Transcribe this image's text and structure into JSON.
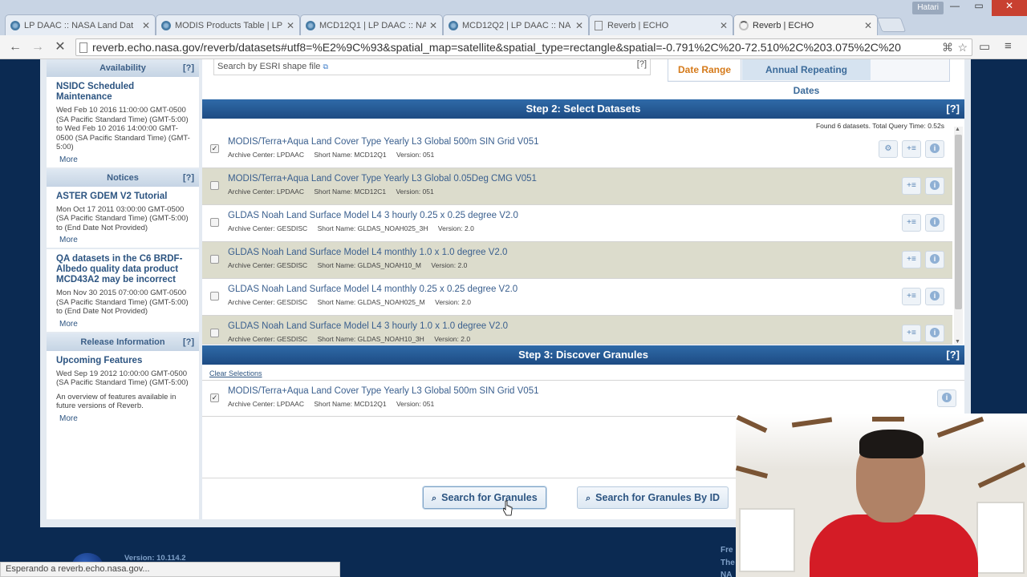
{
  "browser": {
    "tabs": [
      {
        "title": "LP DAAC :: NASA Land Dat",
        "active": false
      },
      {
        "title": "MODIS Products Table | LP",
        "active": false
      },
      {
        "title": "MCD12Q1 | LP DAAC :: NA",
        "active": false
      },
      {
        "title": "MCD12Q2 | LP DAAC :: NA",
        "active": false
      },
      {
        "title": "Reverb | ECHO",
        "active": false
      },
      {
        "title": "Reverb | ECHO",
        "active": true
      }
    ],
    "user": "Hatari",
    "url": "reverb.echo.nasa.gov/reverb/datasets#utf8=%E2%9C%93&spatial_map=satellite&spatial_type=rectangle&spatial=-0.791%2C%20-72.510%2C%203.075%2C%20",
    "status": "Esperando a reverb.echo.nasa.gov..."
  },
  "sidebar": {
    "availability": {
      "header": "Availability",
      "help": "[?]",
      "item": {
        "title": "NSIDC Scheduled Maintenance",
        "text": "Wed Feb 10 2016 11:00:00 GMT-0500 (SA Pacific Standard Time) (GMT-5:00) to Wed Feb 10 2016 14:00:00 GMT-0500 (SA Pacific Standard Time) (GMT-5:00)",
        "more": "More"
      }
    },
    "notices": {
      "header": "Notices",
      "help": "[?]",
      "items": [
        {
          "title": "ASTER GDEM V2 Tutorial",
          "text": "Mon Oct 17 2011 03:00:00 GMT-0500 (SA Pacific Standard Time) (GMT-5:00) to (End Date Not Provided)",
          "more": "More"
        },
        {
          "title": "QA datasets in the C6 BRDF-Albedo quality data product MCD43A2 may be incorrect",
          "text": "Mon Nov 30 2015 07:00:00 GMT-0500 (SA Pacific Standard Time) (GMT-5:00) to (End Date Not Provided)",
          "more": "More"
        }
      ]
    },
    "release": {
      "header": "Release Information",
      "help": "[?]",
      "item": {
        "title": "Upcoming Features",
        "text": "Wed Sep 19 2012 10:00:00 GMT-0500 (SA Pacific Standard Time) (GMT-5:00)",
        "extra": "An overview of features available in future versions of Reverb.",
        "more": "More"
      }
    }
  },
  "spatial": {
    "shape_link": "Search by ESRI shape file",
    "help": "[?]"
  },
  "temporal": {
    "date_range": "Date Range",
    "annual": "Annual Repeating Dates"
  },
  "step2": {
    "title": "Step 2: Select Datasets",
    "help": "[?]",
    "found": "Found 6 datasets. Total Query Time: 0.52s",
    "datasets": [
      {
        "title": "MODIS/Terra+Aqua Land Cover Type Yearly L3 Global 500m SIN Grid V051",
        "archive": "Archive Center: LPDAAC",
        "short": "Short Name: MCD12Q1",
        "version": "Version: 051",
        "checked": true
      },
      {
        "title": "MODIS/Terra+Aqua Land Cover Type Yearly L3 Global 0.05Deg CMG V051",
        "archive": "Archive Center: LPDAAC",
        "short": "Short Name: MCD12C1",
        "version": "Version: 051",
        "checked": false
      },
      {
        "title": "GLDAS Noah Land Surface Model L4 3 hourly 0.25 x 0.25 degree V2.0",
        "archive": "Archive Center: GESDISC",
        "short": "Short Name: GLDAS_NOAH025_3H",
        "version": "Version: 2.0",
        "checked": false
      },
      {
        "title": "GLDAS Noah Land Surface Model L4 monthly 1.0 x 1.0 degree V2.0",
        "archive": "Archive Center: GESDISC",
        "short": "Short Name: GLDAS_NOAH10_M",
        "version": "Version: 2.0",
        "checked": false
      },
      {
        "title": "GLDAS Noah Land Surface Model L4 monthly 0.25 x 0.25 degree V2.0",
        "archive": "Archive Center: GESDISC",
        "short": "Short Name: GLDAS_NOAH025_M",
        "version": "Version: 2.0",
        "checked": false
      },
      {
        "title": "GLDAS Noah Land Surface Model L4 3 hourly 1.0 x 1.0 degree V2.0",
        "archive": "Archive Center: GESDISC",
        "short": "Short Name: GLDAS_NOAH10_3H",
        "version": "Version: 2.0",
        "checked": false
      }
    ]
  },
  "step3": {
    "title": "Step 3: Discover Granules",
    "help": "[?]",
    "clear": "Clear Selections",
    "selected": {
      "title": "MODIS/Terra+Aqua Land Cover Type Yearly L3 Global 500m SIN Grid V051",
      "archive": "Archive Center: LPDAAC",
      "short": "Short Name: MCD12Q1",
      "version": "Version: 051"
    }
  },
  "actions": {
    "search_granules": "Search for Granules",
    "search_by_id": "Search for Granules By ID"
  },
  "footer": {
    "version": "Version: 10.114.2",
    "line1": "Fre",
    "line2": "The",
    "line3": "NA"
  },
  "colors": {
    "step_bar": "#1d4b83",
    "accent_orange": "#d57a1a",
    "row_alt": "#dcdccc"
  }
}
